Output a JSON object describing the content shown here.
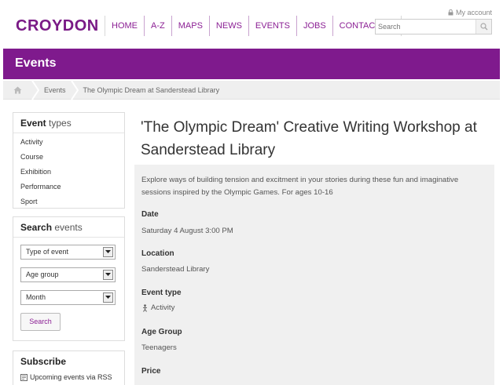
{
  "header": {
    "logo": "CROYDON",
    "nav": [
      "HOME",
      "A-Z",
      "MAPS",
      "NEWS",
      "EVENTS",
      "JOBS",
      "CONTACT US"
    ],
    "account_label": "My account",
    "search_placeholder": "Search"
  },
  "band": {
    "title": "Events"
  },
  "breadcrumb": {
    "items": [
      "Events",
      "The Olympic Dream at Sanderstead Library"
    ]
  },
  "sidebar": {
    "types": {
      "title_bold": "Event",
      "title_rest": " types",
      "items": [
        "Activity",
        "Course",
        "Exhibition",
        "Performance",
        "Sport"
      ]
    },
    "search": {
      "title_bold": "Search",
      "title_rest": " events",
      "selects": [
        "Type of event",
        "Age group",
        "Month"
      ],
      "button": "Search"
    },
    "subscribe": {
      "title": "Subscribe",
      "rss": "Upcoming events via RSS"
    }
  },
  "event": {
    "title": "'The Olympic Dream' Creative Writing Workshop at Sanderstead Library",
    "intro": "Explore ways of building tension and excitment in your stories during these fun and imaginative sessions inspired by the Olympic Games. For ages 10-16",
    "fields": [
      {
        "label": "Date",
        "value": "Saturday 4 August 3:00 PM"
      },
      {
        "label": "Location",
        "value": "Sanderstead Library"
      },
      {
        "label": "Event type",
        "value": "Activity"
      },
      {
        "label": "Age Group",
        "value": "Teenagers"
      },
      {
        "label": "Price",
        "value": ""
      }
    ]
  },
  "colors": {
    "brand": "#7f1a8d",
    "panel": "#f0f0f0"
  }
}
